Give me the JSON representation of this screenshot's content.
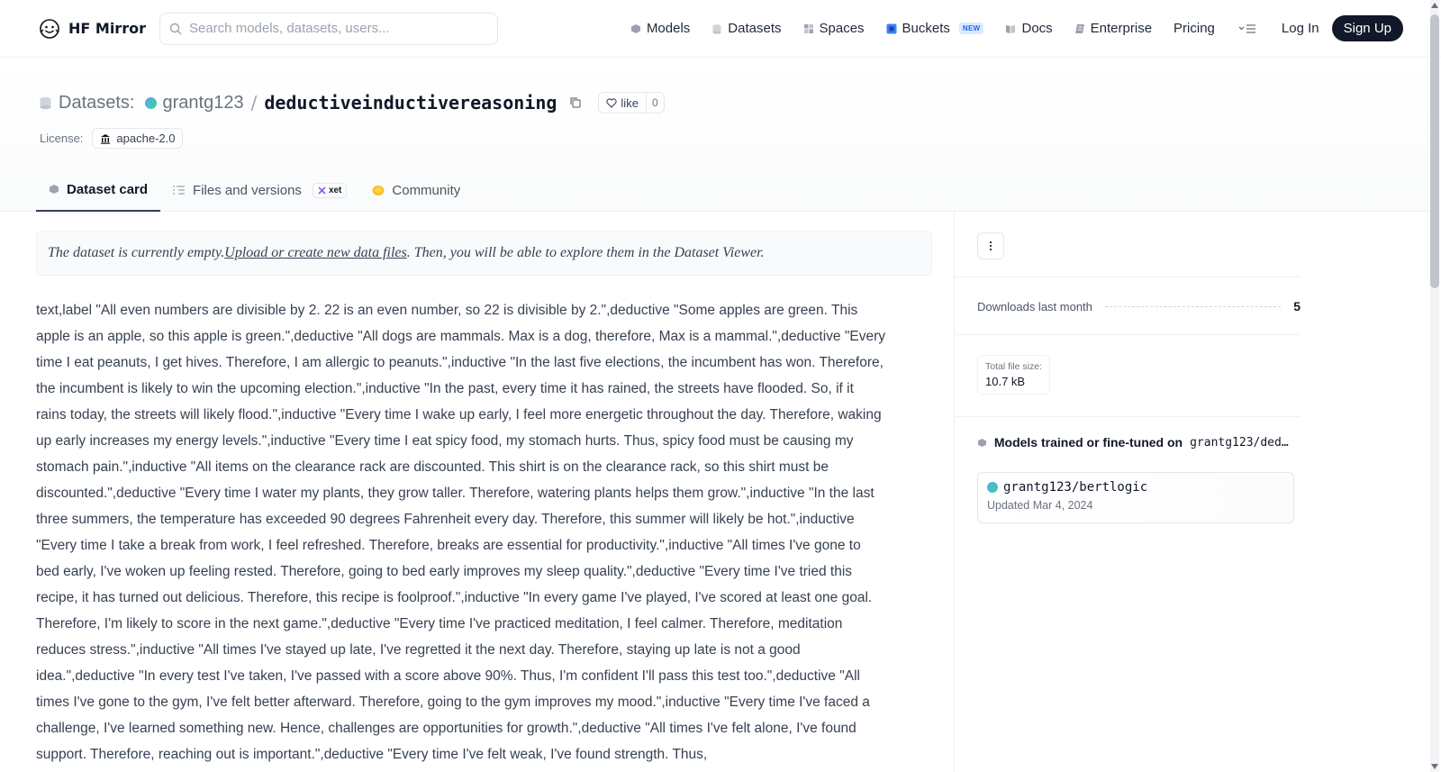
{
  "header": {
    "brand": "HF Mirror",
    "search_placeholder": "Search models, datasets, users...",
    "nav": [
      {
        "label": "Models",
        "icon": "models-icon"
      },
      {
        "label": "Datasets",
        "icon": "datasets-icon"
      },
      {
        "label": "Spaces",
        "icon": "spaces-icon"
      },
      {
        "label": "Buckets",
        "icon": "buckets-icon",
        "badge": "NEW"
      },
      {
        "label": "Docs",
        "icon": "docs-icon"
      },
      {
        "label": "Enterprise",
        "icon": "enterprise-icon"
      },
      {
        "label": "Pricing"
      }
    ],
    "login": "Log In",
    "signup": "Sign Up"
  },
  "repo": {
    "type_label": "Datasets:",
    "owner": "grantg123",
    "slash": "/",
    "name": "deductiveinductivereasoning",
    "like_label": "like",
    "like_count": "0",
    "license_label": "License:",
    "license": "apache-2.0"
  },
  "tabs": [
    {
      "label": "Dataset card",
      "active": true
    },
    {
      "label": "Files and versions",
      "badge": "xet"
    },
    {
      "label": "Community"
    }
  ],
  "notice": {
    "before": "The dataset is currently empty. ",
    "link": "Upload or create new data files",
    "after": ". Then, you will be able to explore them in the Dataset Viewer."
  },
  "body_text": "text,label \"All even numbers are divisible by 2. 22 is an even number, so 22 is divisible by 2.\",deductive \"Some apples are green. This apple is an apple, so this apple is green.\",deductive \"All dogs are mammals. Max is a dog, therefore, Max is a mammal.\",deductive \"Every time I eat peanuts, I get hives. Therefore, I am allergic to peanuts.\",inductive \"In the last five elections, the incumbent has won. Therefore, the incumbent is likely to win the upcoming election.\",inductive \"In the past, every time it has rained, the streets have flooded. So, if it rains today, the streets will likely flood.\",inductive \"Every time I wake up early, I feel more energetic throughout the day. Therefore, waking up early increases my energy levels.\",inductive \"Every time I eat spicy food, my stomach hurts. Thus, spicy food must be causing my stomach pain.\",inductive \"All items on the clearance rack are discounted. This shirt is on the clearance rack, so this shirt must be discounted.\",deductive \"Every time I water my plants, they grow taller. Therefore, watering plants helps them grow.\",inductive \"In the last three summers, the temperature has exceeded 90 degrees Fahrenheit every day. Therefore, this summer will likely be hot.\",inductive \"Every time I take a break from work, I feel refreshed. Therefore, breaks are essential for productivity.\",inductive \"All times I've gone to bed early, I've woken up feeling rested. Therefore, going to bed early improves my sleep quality.\",deductive \"Every time I've tried this recipe, it has turned out delicious. Therefore, this recipe is foolproof.\",inductive \"In every game I've played, I've scored at least one goal. Therefore, I'm likely to score in the next game.\",deductive \"Every time I've practiced meditation, I feel calmer. Therefore, meditation reduces stress.\",inductive \"All times I've stayed up late, I've regretted it the next day. Therefore, staying up late is not a good idea.\",deductive \"In every test I've taken, I've passed with a score above 90%. Thus, I'm confident I'll pass this test too.\",deductive \"All times I've gone to the gym, I've felt better afterward. Therefore, going to the gym improves my mood.\",inductive \"Every time I've faced a challenge, I've learned something new. Hence, challenges are opportunities for growth.\",deductive \"All times I've felt alone, I've found support. Therefore, reaching out is important.\",deductive \"Every time I've felt weak, I've found strength. Thus,",
  "sidebar": {
    "downloads_label": "Downloads last month",
    "downloads_value": "5",
    "size_label": "Total file size:",
    "size_value": "10.7 kB",
    "models_title": "Models trained or fine-tuned on",
    "models_repo": "grantg123/dedu…",
    "model": {
      "name": "grantg123/bertlogic",
      "updated": "Updated Mar 4, 2024"
    }
  }
}
